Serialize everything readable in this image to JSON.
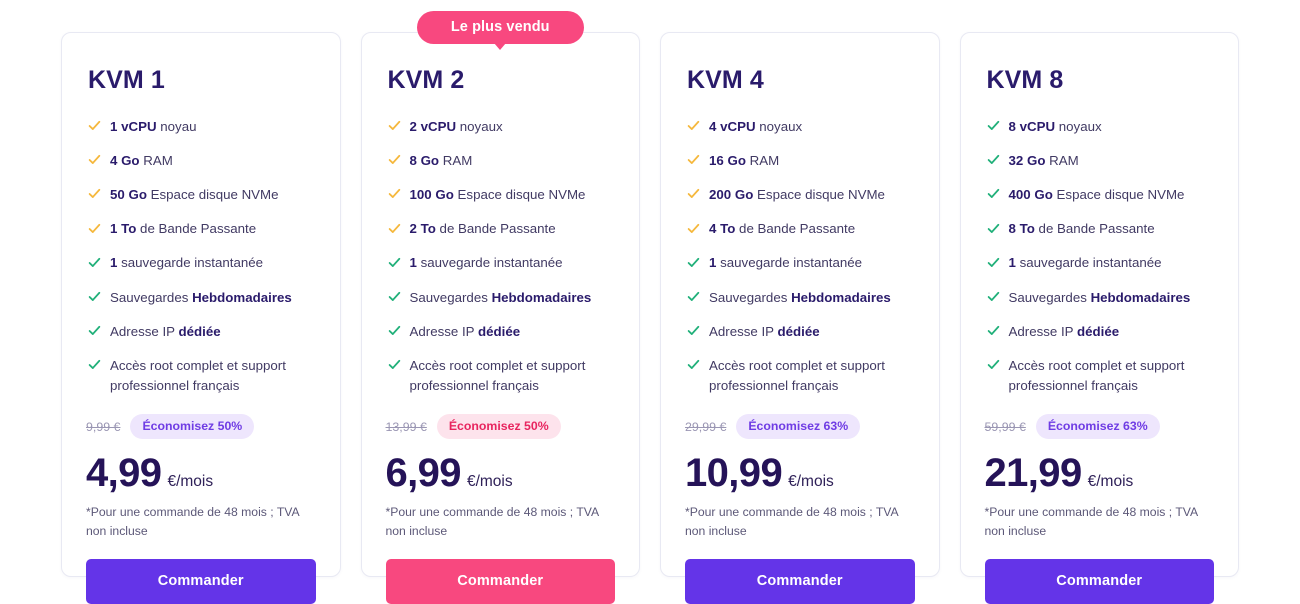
{
  "theme": {
    "purple": "#6434e8",
    "pink": "#f8487f",
    "navy": "#2a1b6b",
    "check_amber": "#f5b83d",
    "check_green": "#21b07a",
    "card_border": "#e8e9f3"
  },
  "featured_badge": {
    "label": "Le plus vendu"
  },
  "plans": [
    {
      "id": "kvm-1",
      "title": "KVM 1",
      "featured": false,
      "features": [
        {
          "strong": "1 vCPU",
          "rest": " noyau",
          "check": "amber"
        },
        {
          "strong": "4 Go",
          "rest": " RAM",
          "check": "amber"
        },
        {
          "strong": "50 Go",
          "rest": " Espace disque NVMe",
          "check": "amber"
        },
        {
          "strong": "1 To",
          "rest": " de Bande Passante",
          "check": "amber"
        },
        {
          "strong": "1",
          "rest": " sauvegarde instantanée",
          "check": "green"
        },
        {
          "pre": "Sauvegardes ",
          "strong": "Hebdomadaires",
          "rest": "",
          "check": "green"
        },
        {
          "pre": "Adresse IP ",
          "strong": "dédiée",
          "rest": "",
          "check": "green"
        },
        {
          "pre": "Accès root complet et support professionnel français",
          "strong": "",
          "rest": "",
          "check": "green"
        }
      ],
      "old_price": "9,99 €",
      "save_label": "Économisez 50%",
      "save_style": "purple",
      "price_amount": "4,99",
      "price_suffix": "€/mois",
      "price_note": "*Pour une commande de 48 mois ; TVA non incluse",
      "button_label": "Commander",
      "button_style": "purple"
    },
    {
      "id": "kvm-2",
      "title": "KVM 2",
      "featured": true,
      "features": [
        {
          "strong": "2 vCPU",
          "rest": " noyaux",
          "check": "amber"
        },
        {
          "strong": "8 Go",
          "rest": " RAM",
          "check": "amber"
        },
        {
          "strong": "100 Go",
          "rest": " Espace disque NVMe",
          "check": "amber"
        },
        {
          "strong": "2 To",
          "rest": " de Bande Passante",
          "check": "amber"
        },
        {
          "strong": "1",
          "rest": " sauvegarde instantanée",
          "check": "green"
        },
        {
          "pre": "Sauvegardes ",
          "strong": "Hebdomadaires",
          "rest": "",
          "check": "green"
        },
        {
          "pre": "Adresse IP ",
          "strong": "dédiée",
          "rest": "",
          "check": "green"
        },
        {
          "pre": "Accès root complet et support professionnel français",
          "strong": "",
          "rest": "",
          "check": "green"
        }
      ],
      "old_price": "13,99 €",
      "save_label": "Économisez 50%",
      "save_style": "pink",
      "price_amount": "6,99",
      "price_suffix": "€/mois",
      "price_note": "*Pour une commande de 48 mois ; TVA non incluse",
      "button_label": "Commander",
      "button_style": "pink"
    },
    {
      "id": "kvm-4",
      "title": "KVM 4",
      "featured": false,
      "features": [
        {
          "strong": "4 vCPU",
          "rest": " noyaux",
          "check": "amber"
        },
        {
          "strong": "16 Go",
          "rest": " RAM",
          "check": "amber"
        },
        {
          "strong": "200 Go",
          "rest": " Espace disque NVMe",
          "check": "amber"
        },
        {
          "strong": "4 To",
          "rest": " de Bande Passante",
          "check": "amber"
        },
        {
          "strong": "1",
          "rest": " sauvegarde instantanée",
          "check": "green"
        },
        {
          "pre": "Sauvegardes ",
          "strong": "Hebdomadaires",
          "rest": "",
          "check": "green"
        },
        {
          "pre": "Adresse IP ",
          "strong": "dédiée",
          "rest": "",
          "check": "green"
        },
        {
          "pre": "Accès root complet et support professionnel français",
          "strong": "",
          "rest": "",
          "check": "green"
        }
      ],
      "old_price": "29,99 €",
      "save_label": "Économisez 63%",
      "save_style": "purple",
      "price_amount": "10,99",
      "price_suffix": "€/mois",
      "price_note": "*Pour une commande de 48 mois ; TVA non incluse",
      "button_label": "Commander",
      "button_style": "purple"
    },
    {
      "id": "kvm-8",
      "title": "KVM 8",
      "featured": false,
      "features": [
        {
          "strong": "8 vCPU",
          "rest": " noyaux",
          "check": "green"
        },
        {
          "strong": "32 Go",
          "rest": " RAM",
          "check": "green"
        },
        {
          "strong": "400 Go",
          "rest": " Espace disque NVMe",
          "check": "green"
        },
        {
          "strong": "8 To",
          "rest": " de Bande Passante",
          "check": "green"
        },
        {
          "strong": "1",
          "rest": " sauvegarde instantanée",
          "check": "green"
        },
        {
          "pre": "Sauvegardes ",
          "strong": "Hebdomadaires",
          "rest": "",
          "check": "green"
        },
        {
          "pre": "Adresse IP ",
          "strong": "dédiée",
          "rest": "",
          "check": "green"
        },
        {
          "pre": "Accès root complet et support professionnel français",
          "strong": "",
          "rest": "",
          "check": "green"
        }
      ],
      "old_price": "59,99 €",
      "save_label": "Économisez 63%",
      "save_style": "purple",
      "price_amount": "21,99",
      "price_suffix": "€/mois",
      "price_note": "*Pour une commande de 48 mois ; TVA non incluse",
      "button_label": "Commander",
      "button_style": "purple"
    }
  ]
}
